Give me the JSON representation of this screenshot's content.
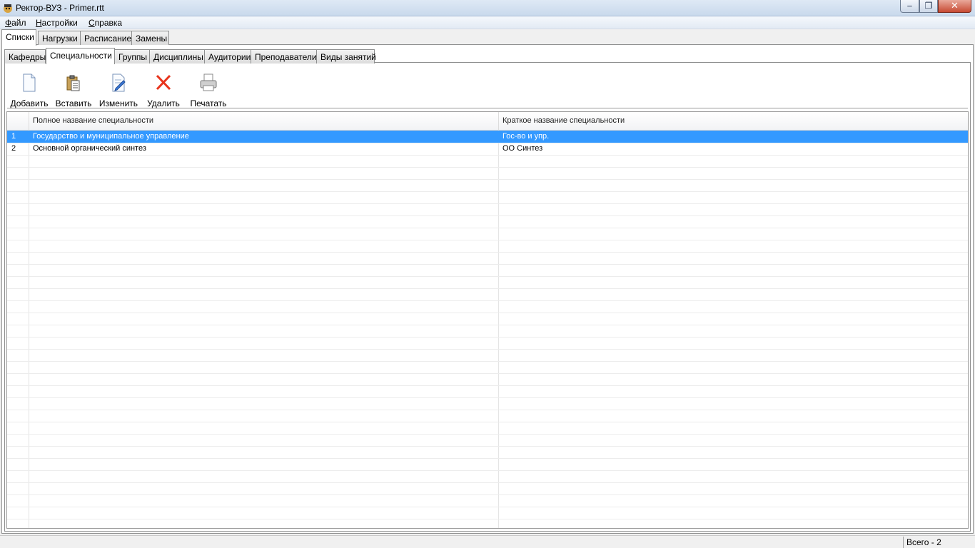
{
  "window": {
    "title": "Ректор-ВУЗ - Primer.rtt"
  },
  "menu": [
    "Файл",
    "Настройки",
    "Справка"
  ],
  "main_tabs": [
    {
      "label": "Списки",
      "active": true
    },
    {
      "label": "Нагрузки",
      "active": false
    },
    {
      "label": "Расписание",
      "active": false
    },
    {
      "label": "Замены",
      "active": false
    }
  ],
  "sub_tabs": [
    {
      "label": "Кафедры",
      "active": false
    },
    {
      "label": "Специальности",
      "active": true
    },
    {
      "label": "Группы",
      "active": false
    },
    {
      "label": "Дисциплины",
      "active": false
    },
    {
      "label": "Аудитории",
      "active": false
    },
    {
      "label": "Преподаватели",
      "active": false
    },
    {
      "label": "Виды занятий",
      "active": false
    }
  ],
  "toolbar": [
    {
      "label": "Добавить",
      "icon": "new-document-icon"
    },
    {
      "label": "Вставить",
      "icon": "paste-icon"
    },
    {
      "label": "Изменить",
      "icon": "edit-icon"
    },
    {
      "label": "Удалить",
      "icon": "delete-icon"
    },
    {
      "label": "Печатать",
      "icon": "printer-icon"
    }
  ],
  "table": {
    "columns": [
      "Полное название специальности",
      "Краткое название специальности"
    ],
    "rows": [
      {
        "num": "1",
        "full": "Государство и муниципальное управление",
        "short": "Гос-во и упр.",
        "selected": true
      },
      {
        "num": "2",
        "full": "Основной органический синтез",
        "short": "ОО Синтез",
        "selected": false
      }
    ]
  },
  "status": {
    "text": "Всего - 2"
  },
  "colors": {
    "selection": "#3399ff",
    "close_button": "#c74a33"
  }
}
